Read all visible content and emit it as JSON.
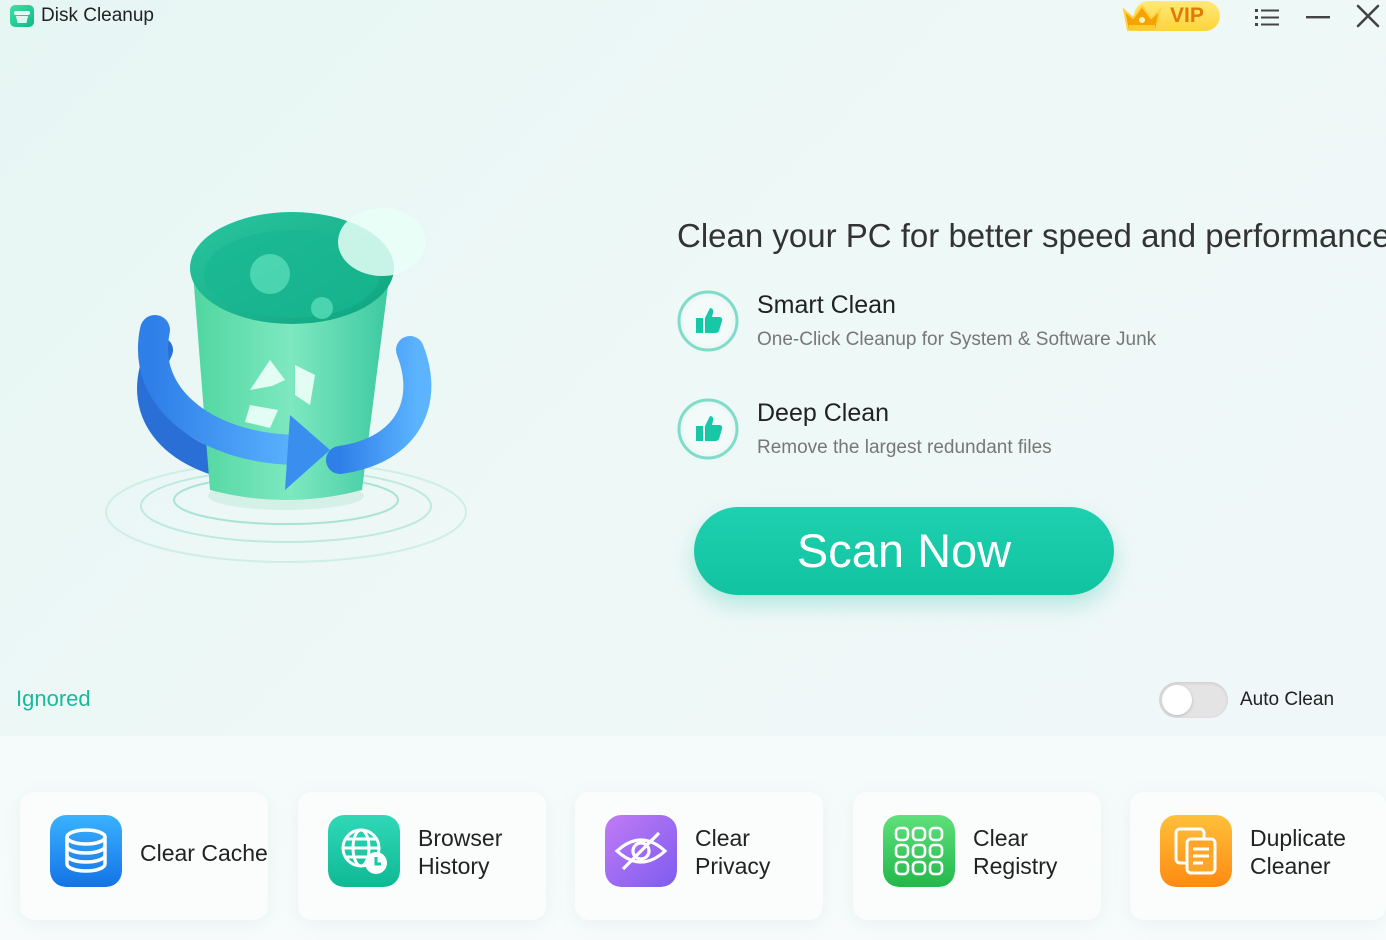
{
  "app": {
    "title": "Disk Cleanup",
    "vip_label": "VIP"
  },
  "main": {
    "headline": "Clean your PC for better speed and performance",
    "features": [
      {
        "title": "Smart Clean",
        "description": "One-Click Cleanup for System & Software Junk"
      },
      {
        "title": "Deep Clean",
        "description": "Remove the largest redundant files"
      }
    ],
    "scan_button": "Scan Now",
    "ignored_link": "Ignored",
    "auto_clean": {
      "label": "Auto Clean",
      "enabled": false
    }
  },
  "tools": [
    {
      "label_line1": "Clear Cache",
      "label_line2": "",
      "icon": "database-icon",
      "color": "#1a8cf0"
    },
    {
      "label_line1": "Browser",
      "label_line2": "History",
      "icon": "globe-clock-icon",
      "color": "#16c6a5"
    },
    {
      "label_line1": "Clear",
      "label_line2": "Privacy",
      "icon": "eye-slash-icon",
      "color": "#9a6af0"
    },
    {
      "label_line1": "Clear",
      "label_line2": "Registry",
      "icon": "grid-icon",
      "color": "#3ccd60"
    },
    {
      "label_line1": "Duplicate",
      "label_line2": "Cleaner",
      "icon": "copy-document-icon",
      "color": "#ff9e1c"
    }
  ],
  "colors": {
    "accent": "#17c7a6",
    "vip": "#ffd33b"
  }
}
